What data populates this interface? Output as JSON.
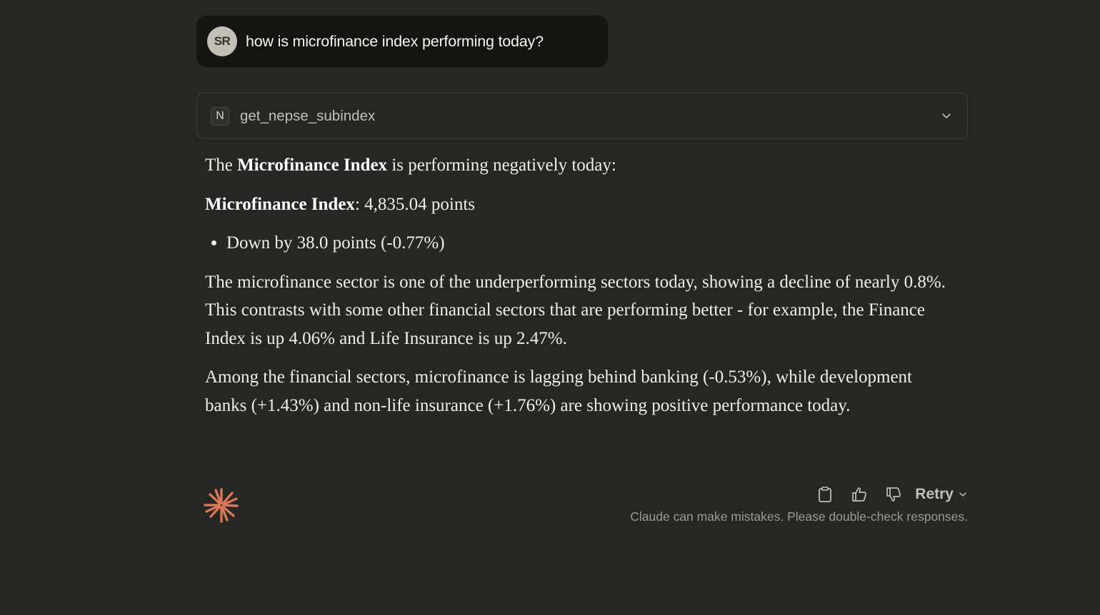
{
  "user_message": {
    "avatar_initials": "SR",
    "text": "how is microfinance index performing today?"
  },
  "tool_call": {
    "badge": "N",
    "name": "get_nepse_subindex",
    "icon": "chevron-down-icon"
  },
  "answer": {
    "p1_pre": "The ",
    "p1_bold": "Microfinance Index",
    "p1_post": " is performing negatively today:",
    "p2_bold": "Microfinance Index",
    "p2_post": ": 4,835.04 points",
    "bullet": "Down by 38.0 points (-0.77%)",
    "p3": "The microfinance sector is one of the underperforming sectors today, showing a decline of nearly 0.8%. This contrasts with some other financial sectors that are performing better - for example, the Finance Index is up 4.06% and Life Insurance is up 2.47%.",
    "p4": "Among the financial sectors, microfinance is lagging behind banking (-0.53%), while development banks (+1.43%) and non-life insurance (+1.76%) are showing positive performance today."
  },
  "footer": {
    "logo_icon": "claude-spark-icon",
    "copy_icon": "clipboard-icon",
    "thumbs_up_icon": "thumbs-up-icon",
    "thumbs_down_icon": "thumbs-down-icon",
    "retry_label": "Retry",
    "disclaimer": "Claude can make mistakes. Please double-check responses."
  },
  "colors": {
    "background": "#262624",
    "user_bubble": "#141413",
    "accent": "#d97757"
  }
}
